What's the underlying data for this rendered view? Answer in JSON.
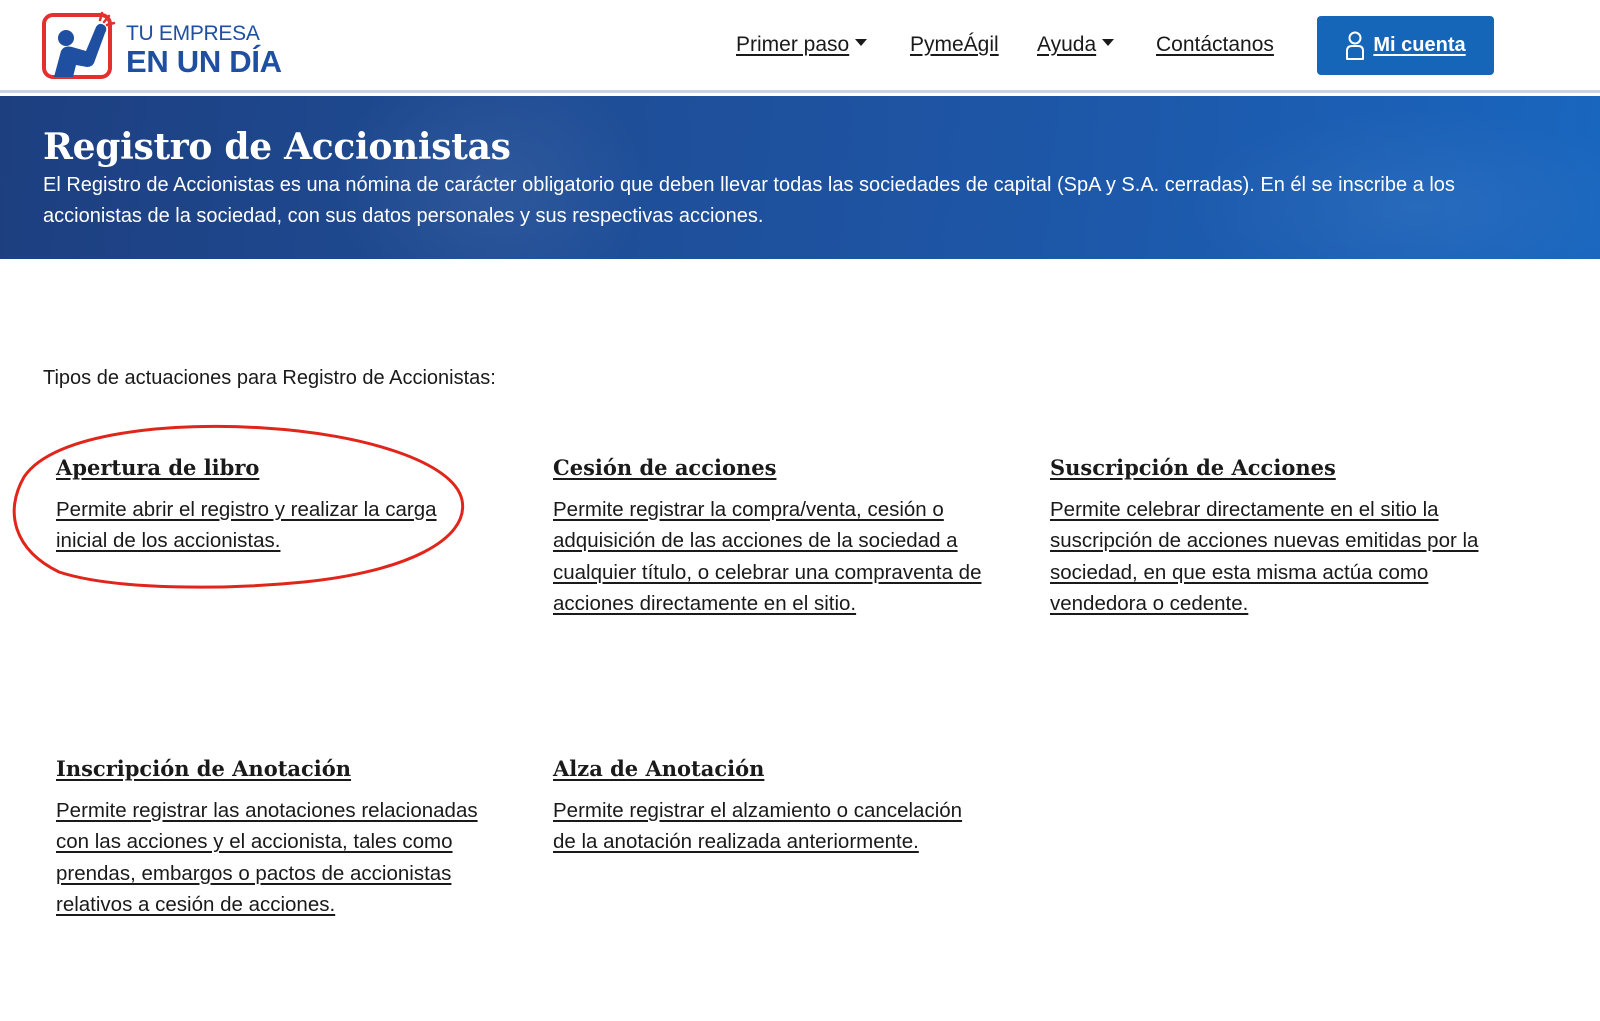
{
  "logo": {
    "line1": "TU EMPRESA",
    "line2": "EN UN DÍA"
  },
  "nav": {
    "items": [
      {
        "label": "Primer paso",
        "dropdown": true
      },
      {
        "label": "PymeÁgil",
        "dropdown": false
      },
      {
        "label": "Ayuda",
        "dropdown": true
      },
      {
        "label": "Contáctanos",
        "dropdown": false
      }
    ],
    "account_label": "Mi cuenta",
    "account_icon": "user-icon"
  },
  "hero": {
    "title": "Registro de Accionistas",
    "description": "El Registro de Accionistas es una nómina de carácter obligatorio que deben llevar todas las sociedades de capital (SpA y S.A. cerradas). En él se inscribe a los accionistas de la sociedad, con sus datos personales y sus respectivas acciones."
  },
  "content": {
    "intro": "Tipos de actuaciones para Registro de Accionistas:",
    "cards": [
      {
        "title": "Apertura de libro",
        "description": "Permite abrir el registro y realizar la carga inicial de los accionistas."
      },
      {
        "title": "Cesión de acciones",
        "description": "Permite registrar la compra/venta, cesión o adquisición de las acciones de la sociedad a cualquier título, o celebrar una compraventa de acciones directamente en el sitio."
      },
      {
        "title": "Suscripción de Acciones",
        "description": "Permite celebrar directamente en el sitio la suscripción de acciones nuevas emitidas por la sociedad, en que esta misma actúa como vendedora o cedente."
      },
      {
        "title": "Inscripción de Anotación",
        "description": "Permite registrar las anotaciones relacionadas con las acciones y el accionista, tales como prendas, embargos o pactos de accionistas relativos a cesión de acciones."
      },
      {
        "title": "Alza de Anotación",
        "description": "Permite registrar el alzamiento o cancelación de la anotación realizada anteriormente."
      }
    ]
  },
  "colors": {
    "brand_blue": "#1f4fa0",
    "brand_red": "#e3302f",
    "button_blue": "#1565b8",
    "annotation_red": "#e0261b"
  }
}
